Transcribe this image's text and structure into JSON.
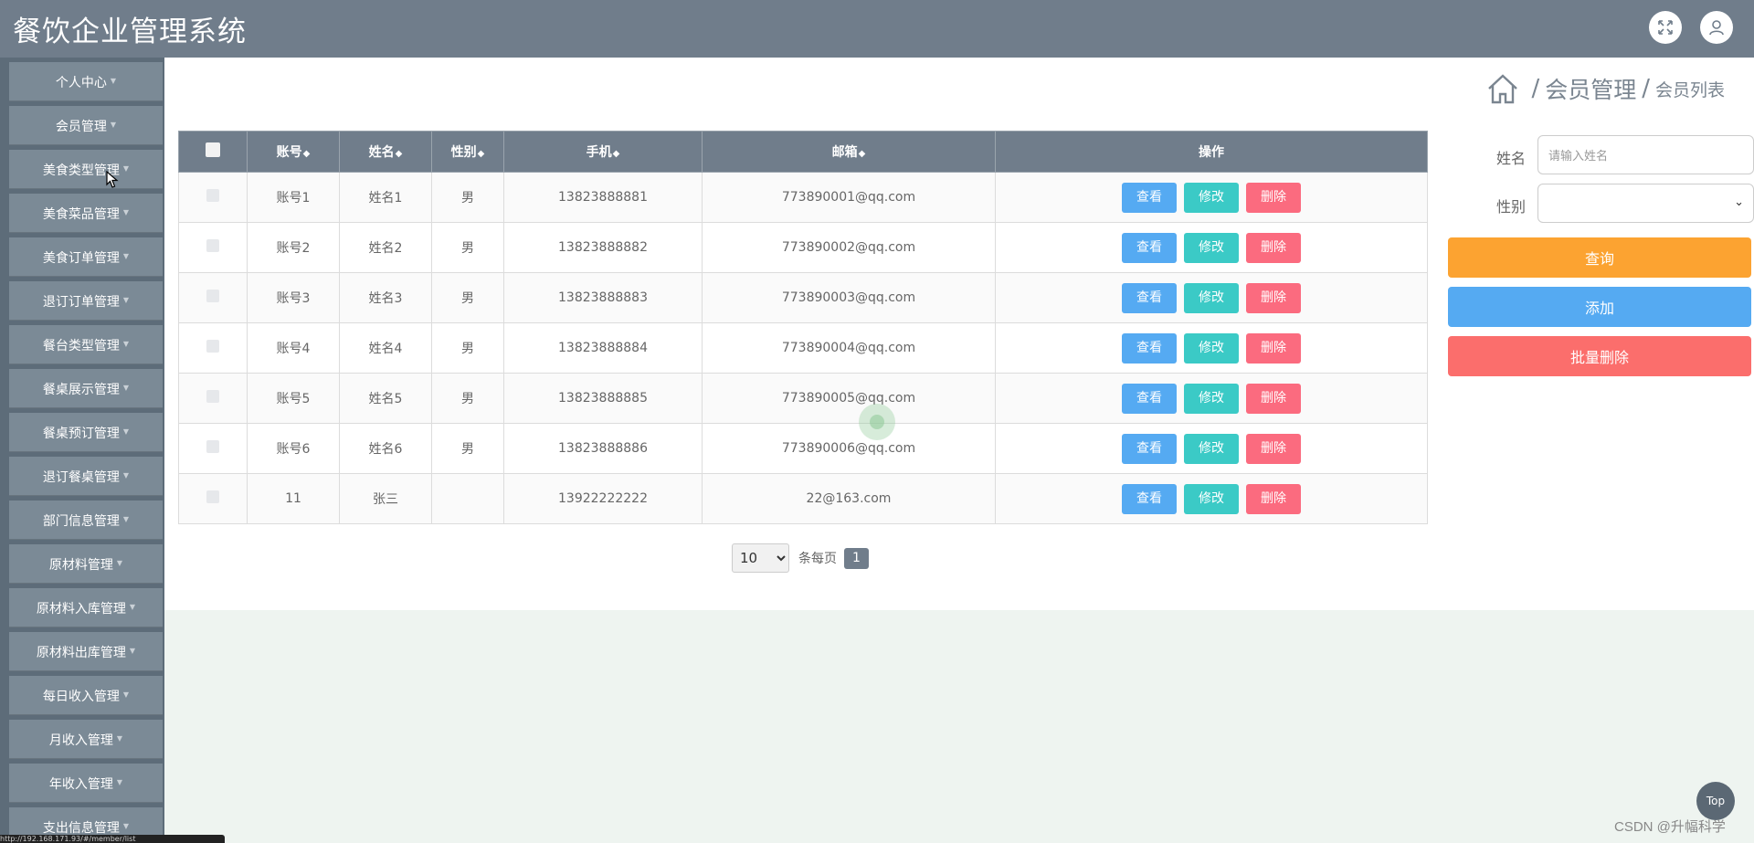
{
  "app": {
    "title": "餐饮企业管理系统"
  },
  "sidebar": {
    "items": [
      {
        "label": "个人中心"
      },
      {
        "label": "会员管理"
      },
      {
        "label": "美食类型管理"
      },
      {
        "label": "美食菜品管理"
      },
      {
        "label": "美食订单管理"
      },
      {
        "label": "退订订单管理"
      },
      {
        "label": "餐台类型管理"
      },
      {
        "label": "餐桌展示管理"
      },
      {
        "label": "餐桌预订管理"
      },
      {
        "label": "退订餐桌管理"
      },
      {
        "label": "部门信息管理"
      },
      {
        "label": "原材料管理"
      },
      {
        "label": "原材料入库管理"
      },
      {
        "label": "原材料出库管理"
      },
      {
        "label": "每日收入管理"
      },
      {
        "label": "月收入管理"
      },
      {
        "label": "年收入管理"
      },
      {
        "label": "支出信息管理"
      }
    ]
  },
  "breadcrumb": {
    "section": "会员管理",
    "page": "会员列表",
    "separator": "/"
  },
  "table": {
    "headers": {
      "account": "账号",
      "name": "姓名",
      "gender": "性别",
      "phone": "手机",
      "email": "邮箱",
      "actions": "操作"
    },
    "sort_symbol": "◆",
    "rows": [
      {
        "account": "账号1",
        "name": "姓名1",
        "gender": "男",
        "phone": "13823888881",
        "email": "773890001@qq.com"
      },
      {
        "account": "账号2",
        "name": "姓名2",
        "gender": "男",
        "phone": "13823888882",
        "email": "773890002@qq.com"
      },
      {
        "account": "账号3",
        "name": "姓名3",
        "gender": "男",
        "phone": "13823888883",
        "email": "773890003@qq.com"
      },
      {
        "account": "账号4",
        "name": "姓名4",
        "gender": "男",
        "phone": "13823888884",
        "email": "773890004@qq.com"
      },
      {
        "account": "账号5",
        "name": "姓名5",
        "gender": "男",
        "phone": "13823888885",
        "email": "773890005@qq.com"
      },
      {
        "account": "账号6",
        "name": "姓名6",
        "gender": "男",
        "phone": "13823888886",
        "email": "773890006@qq.com"
      },
      {
        "account": "11",
        "name": "张三",
        "gender": "",
        "phone": "13922222222",
        "email": "22@163.com"
      }
    ],
    "actions": {
      "view": "查看",
      "edit": "修改",
      "delete": "删除"
    }
  },
  "pagination": {
    "page_size": "10",
    "page_size_options": [
      "10"
    ],
    "per_page_label": "条每页",
    "current_page": "1"
  },
  "filters": {
    "name_label": "姓名",
    "name_placeholder": "请输入姓名",
    "gender_label": "性别",
    "gender_value": ""
  },
  "buttons": {
    "query": "查询",
    "add": "添加",
    "batch_delete": "批量删除"
  },
  "top_button": "Top",
  "watermark": "CSDN @升幅科学",
  "status_url": "http://192.168.171.93/#/member/list",
  "colors": {
    "header": "#707d8b",
    "view": "#55aaf2",
    "edit": "#3bcac6",
    "delete": "#fb6b7f",
    "query": "#fca331",
    "add": "#55aaf2",
    "batch_delete": "#fb6e6c"
  }
}
